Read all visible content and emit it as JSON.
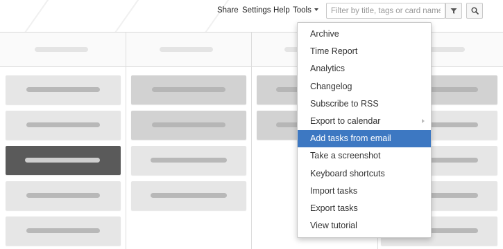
{
  "header": {
    "links": [
      {
        "label": "Share"
      },
      {
        "label": "Settings"
      },
      {
        "label": "Help"
      }
    ],
    "tools_label": "Tools",
    "search": {
      "placeholder": "Filter by title, tags or card name",
      "value": ""
    },
    "icons": {
      "filter": "filter-funnel-icon",
      "search": "magnifier-search-icon"
    }
  },
  "tools_menu": {
    "items": [
      {
        "label": "Archive",
        "has_submenu": false,
        "active": false
      },
      {
        "label": "Time Report",
        "has_submenu": false,
        "active": false
      },
      {
        "label": "Analytics",
        "has_submenu": false,
        "active": false
      },
      {
        "label": "Changelog",
        "has_submenu": false,
        "active": false
      },
      {
        "label": "Subscribe to RSS",
        "has_submenu": false,
        "active": false
      },
      {
        "label": "Export to calendar",
        "has_submenu": true,
        "active": false
      },
      {
        "label": "Add tasks from email",
        "has_submenu": false,
        "active": true
      },
      {
        "label": "Take a screenshot",
        "has_submenu": false,
        "active": false
      },
      {
        "label": "Keyboard shortcuts",
        "has_submenu": false,
        "active": false
      },
      {
        "label": "Import tasks",
        "has_submenu": false,
        "active": false
      },
      {
        "label": "Export tasks",
        "has_submenu": false,
        "active": false
      },
      {
        "label": "View tutorial",
        "has_submenu": false,
        "active": false
      }
    ]
  },
  "colors": {
    "active_item_bg": "#3d78c2",
    "active_item_text": "#ffffff",
    "card_light": "#e6e6e6",
    "card_mid": "#d2d2d2",
    "card_dark": "#5a5a5a",
    "column_border": "#dddddd"
  }
}
